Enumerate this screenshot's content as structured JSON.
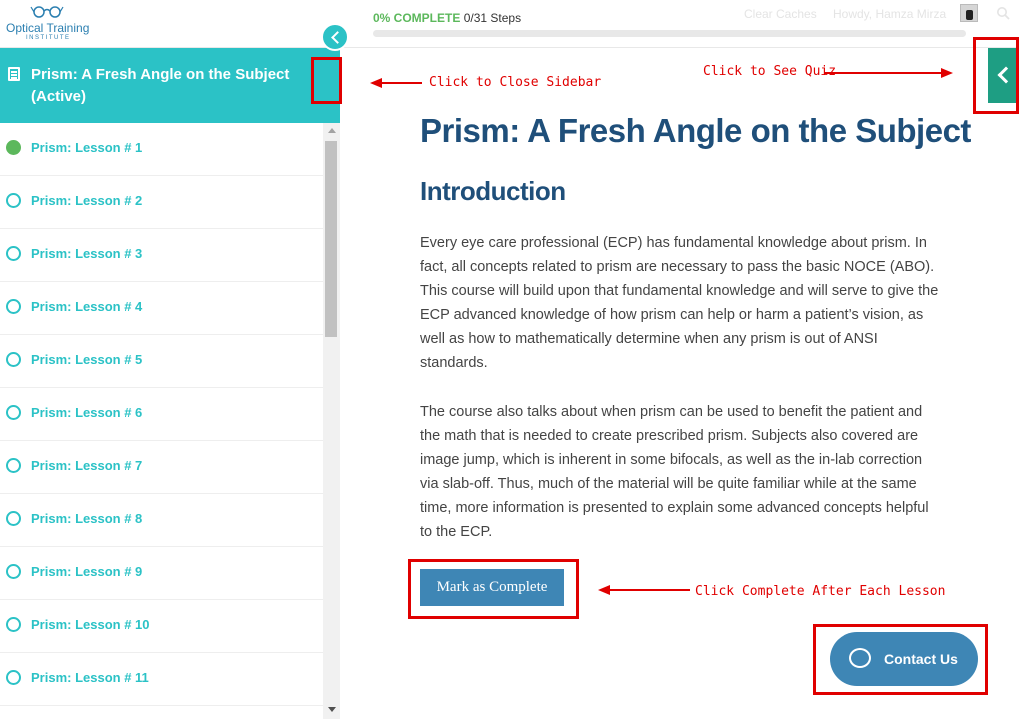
{
  "header": {
    "logo_name": "Optical Training",
    "logo_sub": "INSTITUTE",
    "progress_percent_label": "0% COMPLETE",
    "progress_steps": "0/31 Steps",
    "progress_fraction": 0,
    "clear_caches": "Clear Caches",
    "howdy": "Howdy, Hamza Mirza"
  },
  "sidebar": {
    "title": "Prism: A Fresh Angle on the Subject (Active)",
    "lessons": [
      {
        "label": "Prism: Lesson # 1",
        "done": true
      },
      {
        "label": "Prism: Lesson # 2",
        "done": false
      },
      {
        "label": "Prism: Lesson # 3",
        "done": false
      },
      {
        "label": "Prism: Lesson # 4",
        "done": false
      },
      {
        "label": "Prism: Lesson # 5",
        "done": false
      },
      {
        "label": "Prism: Lesson # 6",
        "done": false
      },
      {
        "label": "Prism: Lesson # 7",
        "done": false
      },
      {
        "label": "Prism: Lesson # 8",
        "done": false
      },
      {
        "label": "Prism: Lesson # 9",
        "done": false
      },
      {
        "label": "Prism: Lesson # 10",
        "done": false
      },
      {
        "label": "Prism: Lesson # 11",
        "done": false
      }
    ]
  },
  "main": {
    "title": "Prism: A Fresh Angle on the Subject",
    "section": "Introduction",
    "paragraph1": "Every eye care professional (ECP) has fundamental knowledge about prism. In fact, all concepts related to prism are necessary to pass the basic NOCE (ABO). This course will build upon that fundamental knowledge and will serve to give the ECP advanced knowledge of how prism can help or harm a patient’s vision, as well as how to mathematically determine when any prism is out of ANSI standards.",
    "paragraph2": "The course also talks about when prism can be used to benefit the patient and the math that is needed to create prescribed prism. Subjects also covered are image jump, which is inherent in some bifocals, as well as the in-lab correction via slab-off. Thus, much of the material will be quite familiar while at the same time, more information is presented to explain some advanced concepts helpful to the ECP.",
    "mark_complete": "Mark as Complete",
    "contact_us": "Contact Us"
  },
  "annotations": {
    "close_sidebar": "Click to Close Sidebar",
    "see_quiz": "Click to See Quiz",
    "complete_each": "Click Complete After Each Lesson"
  },
  "colors": {
    "accent_teal": "#2bc2c6",
    "title_blue": "#1f4f7a",
    "button_blue": "#3e86b5",
    "quiz_green": "#1e9e83",
    "annotation_red": "#e00000"
  }
}
